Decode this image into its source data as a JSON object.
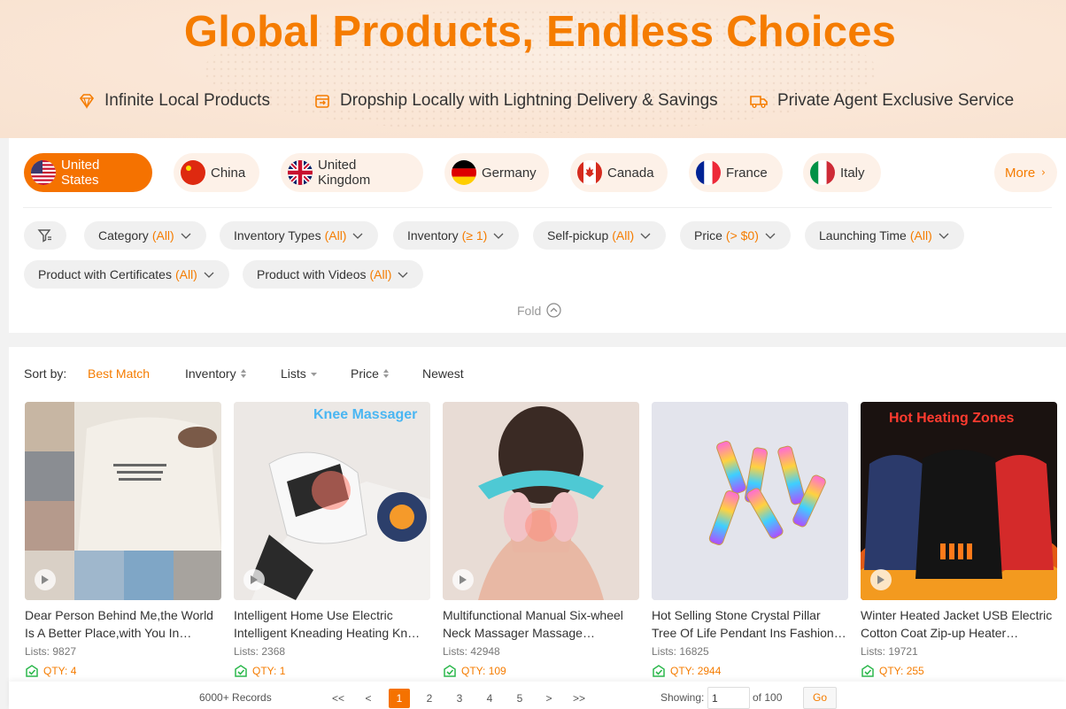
{
  "hero": {
    "title": "Global Products, Endless Choices",
    "features": [
      {
        "icon": "diamond-icon",
        "label": "Infinite Local Products"
      },
      {
        "icon": "cart-dispatch-icon",
        "label": "Dropship Locally with Lightning Delivery & Savings"
      },
      {
        "icon": "delivery-truck-icon",
        "label": "Private Agent Exclusive Service"
      }
    ]
  },
  "countries": [
    {
      "name": "United States",
      "flag": "us-flag-icon",
      "active": true
    },
    {
      "name": "China",
      "flag": "china-flag-icon",
      "active": false
    },
    {
      "name": "United Kingdom",
      "flag": "uk-flag-icon",
      "active": false
    },
    {
      "name": "Germany",
      "flag": "germany-flag-icon",
      "active": false
    },
    {
      "name": "Canada",
      "flag": "canada-flag-icon",
      "active": false
    },
    {
      "name": "France",
      "flag": "france-flag-icon",
      "active": false
    },
    {
      "name": "Italy",
      "flag": "italy-flag-icon",
      "active": false
    }
  ],
  "more_label": "More",
  "filters": [
    {
      "label": "Category",
      "value": "(All)"
    },
    {
      "label": "Inventory Types",
      "value": "(All)"
    },
    {
      "label": "Inventory",
      "value": "(≥ 1)"
    },
    {
      "label": "Self-pickup",
      "value": "(All)"
    },
    {
      "label": "Price",
      "value": "(> $0)"
    },
    {
      "label": "Launching Time",
      "value": "(All)"
    },
    {
      "label": "Product with Certificates",
      "value": "(All)"
    },
    {
      "label": "Product with Videos",
      "value": "(All)"
    }
  ],
  "fold_label": "Fold",
  "sort": {
    "label": "Sort by:",
    "options": [
      "Best Match",
      "Inventory",
      "Lists",
      "Price",
      "Newest"
    ],
    "active": "Best Match"
  },
  "products": [
    {
      "title": "Dear Person Behind Me,the World Is A Better Place,with You In…",
      "lists_label": "Lists:",
      "lists": "9827",
      "qty_label": "QTY:",
      "qty": "4"
    },
    {
      "title": "Intelligent Home Use Electric Intelligent Kneading Heating Kn…",
      "lists_label": "Lists:",
      "lists": "2368",
      "qty_label": "QTY:",
      "qty": "1",
      "image_text": "Knee Massager"
    },
    {
      "title": "Multifunctional Manual Six-wheel Neck Massager Massage Relieve…",
      "lists_label": "Lists:",
      "lists": "42948",
      "qty_label": "QTY:",
      "qty": "109"
    },
    {
      "title": "Hot Selling Stone Crystal Pillar Tree Of Life Pendant Ins Fashion…",
      "lists_label": "Lists:",
      "lists": "16825",
      "qty_label": "QTY:",
      "qty": "2944"
    },
    {
      "title": "Winter Heated Jacket USB Electric Cotton Coat Zip-up Heater…",
      "lists_label": "Lists:",
      "lists": "19721",
      "qty_label": "QTY:",
      "qty": "255",
      "image_text": "Hot Heating Zones"
    }
  ],
  "pagination": {
    "records": "6000+ Records",
    "first": "<<",
    "prev": "<",
    "pages": [
      "1",
      "2",
      "3",
      "4",
      "5"
    ],
    "current": "1",
    "next": ">",
    "last": ">>",
    "showing_label": "Showing:",
    "page_input": "1",
    "of_label": "of 100",
    "go_label": "Go"
  },
  "colors": {
    "accent": "#f57c00",
    "accent_active": "#f57200",
    "qty_icon": "#2db84d"
  }
}
